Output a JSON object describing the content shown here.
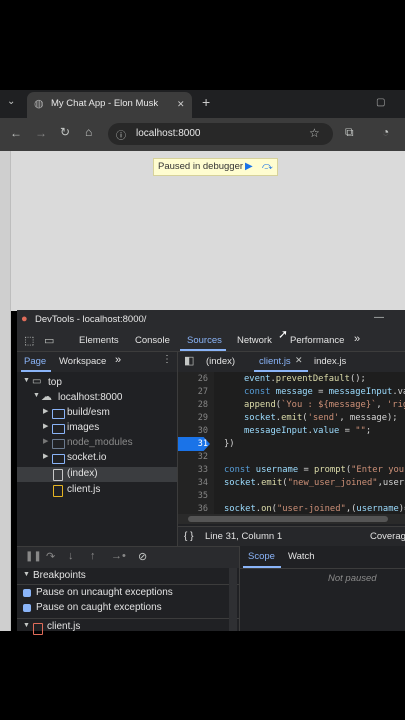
{
  "browser": {
    "tab_title": "My Chat App - Elon Musk",
    "tab_close": "✕",
    "new_tab": "+",
    "address": "localhost:8000",
    "paused_banner": "Paused in debugger"
  },
  "devtools": {
    "title": "DevTools - localhost:8000/",
    "tabs": [
      "Elements",
      "Console",
      "Sources",
      "Network",
      "Performance"
    ],
    "active_tab": "Sources",
    "more": "»",
    "navigator": {
      "tabs": [
        "Page",
        "Workspace"
      ],
      "more": "»",
      "tree": [
        {
          "label": "top",
          "type": "frame"
        },
        {
          "label": "localhost:8000",
          "type": "cloud"
        },
        {
          "label": "build/esm",
          "type": "folder"
        },
        {
          "label": "images",
          "type": "folder"
        },
        {
          "label": "node_modules",
          "type": "folder-dim"
        },
        {
          "label": "socket.io",
          "type": "folder"
        },
        {
          "label": "(index)",
          "type": "file-selected"
        },
        {
          "label": "client.js",
          "type": "file"
        }
      ]
    },
    "editor": {
      "tabs": [
        "(index)",
        "client.js",
        "index.js"
      ],
      "active_tab": "client.js",
      "line_numbers": [
        "26",
        "27",
        "28",
        "29",
        "30",
        "31",
        "32",
        "33",
        "34",
        "35",
        "36"
      ],
      "current_line": "31",
      "status": "Line 31, Column 1",
      "status_right": "Coverag",
      "format_icon": "{ }"
    },
    "debugger": {
      "breakpoints_header": "Breakpoints",
      "options": [
        "Pause on uncaught exceptions",
        "Pause on caught exceptions"
      ],
      "next_file": "client.js"
    },
    "scope": {
      "tabs": [
        "Scope",
        "Watch"
      ],
      "active_tab": "Scope",
      "message": "Not paused"
    }
  },
  "colors": {
    "accent": "#8ab4f8",
    "breakpoint": "#1a73e8",
    "banner": "#fffdd0"
  }
}
